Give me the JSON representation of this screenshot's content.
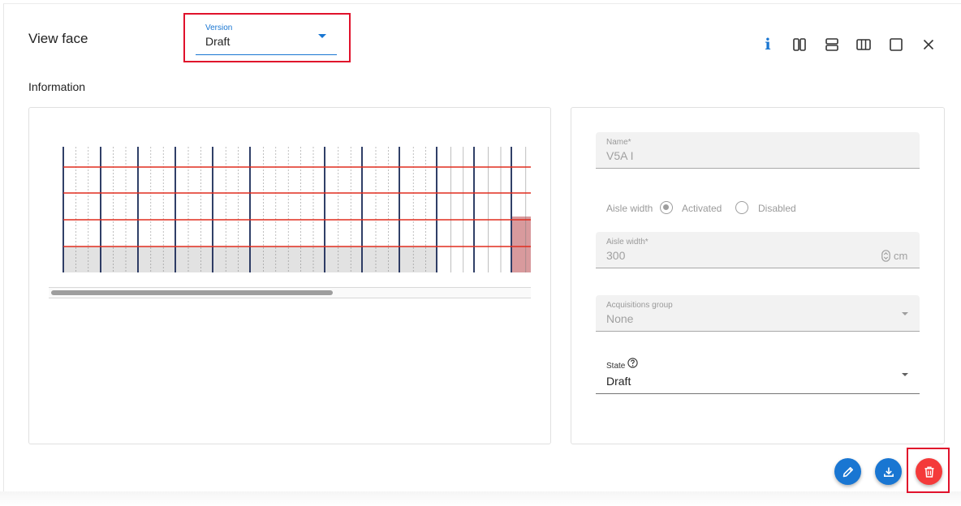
{
  "dialog": {
    "title": "View face",
    "section_title": "Information"
  },
  "version": {
    "label": "Version",
    "value": "Draft"
  },
  "toolbar": {
    "info_glyph": "i",
    "icons": [
      "info-icon",
      "split-vertical-icon",
      "split-horizontal-icon",
      "columns-icon",
      "maximize-icon",
      "close-icon"
    ]
  },
  "form": {
    "name": {
      "label": "Name*",
      "value": "V5A I"
    },
    "aisle_toggle": {
      "label": "Aisle width",
      "options": [
        "Activated",
        "Disabled"
      ],
      "selected": "Activated"
    },
    "aisle_width": {
      "label": "Aisle width*",
      "value": "300",
      "unit": "cm"
    },
    "acquisitions_group": {
      "label": "Acquisitions group",
      "value": "None"
    },
    "state": {
      "label": "State",
      "value": "Draft"
    }
  },
  "actions": {
    "icons": [
      "edit-icon",
      "download-icon",
      "delete-icon"
    ]
  },
  "colors": {
    "accent": "#1976d2",
    "danger": "#f43a3a",
    "highlight_box": "#e0112b",
    "rack_upright": "#1a2a57",
    "rack_beam": "#e02d1e"
  }
}
